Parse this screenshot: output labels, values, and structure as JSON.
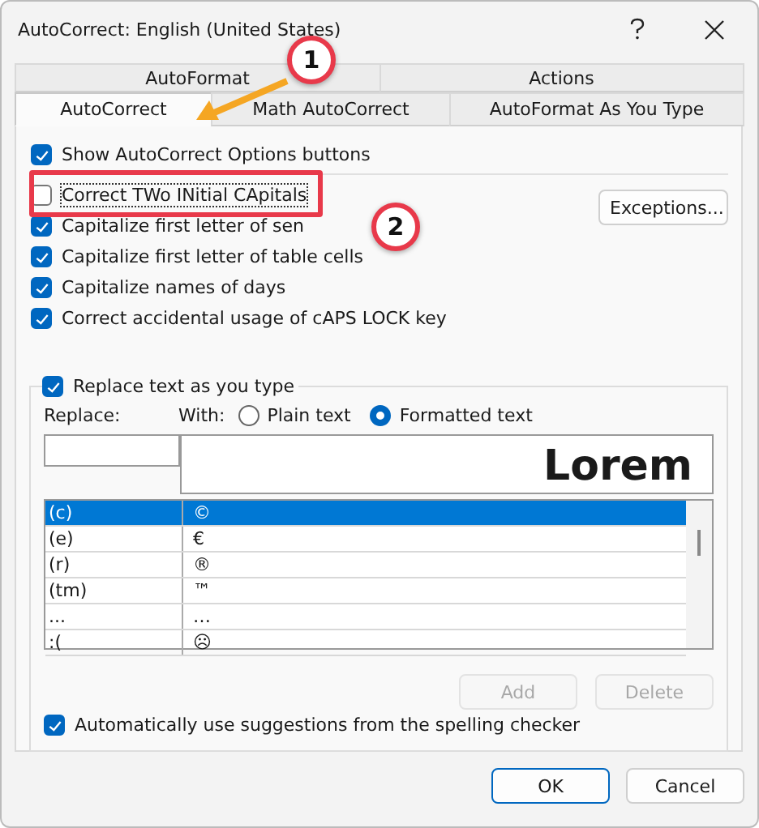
{
  "window": {
    "title": "AutoCorrect: English (United States)"
  },
  "tabs_back": [
    {
      "label": "AutoFormat",
      "selected": false
    },
    {
      "label": "Actions",
      "selected": false
    }
  ],
  "tabs_front": [
    {
      "label": "AutoCorrect",
      "selected": true
    },
    {
      "label": "Math AutoCorrect",
      "selected": false
    },
    {
      "label": "AutoFormat As You Type",
      "selected": false
    }
  ],
  "show_options": {
    "label": "Show AutoCorrect Options buttons",
    "checked": true
  },
  "options": [
    {
      "label": "Correct TWo INitial CApitals",
      "checked": false
    },
    {
      "label": "Capitalize first letter of sen",
      "checked": true
    },
    {
      "label": "Capitalize first letter of table cells",
      "checked": true
    },
    {
      "label": "Capitalize names of days",
      "checked": true
    },
    {
      "label": "Correct accidental usage of cAPS LOCK key",
      "checked": true
    }
  ],
  "exceptions_button": "Exceptions...",
  "replace_group": {
    "label": "Replace text as you type",
    "checked": true
  },
  "replace_label": "Replace:",
  "with_label": "With:",
  "format_options": [
    {
      "label": "Plain text",
      "selected": false
    },
    {
      "label": "Formatted text",
      "selected": true
    }
  ],
  "preview_text": "Lorem",
  "entries": [
    {
      "replace": "(c)",
      "with": "©",
      "selected": true
    },
    {
      "replace": "(e)",
      "with": "€",
      "selected": false
    },
    {
      "replace": "(r)",
      "with": "®",
      "selected": false
    },
    {
      "replace": "(tm)",
      "with": "™",
      "selected": false
    },
    {
      "replace": "...",
      "with": "…",
      "selected": false
    },
    {
      "replace": ":(",
      "with": "☹",
      "selected": false
    }
  ],
  "list_buttons": [
    {
      "label": "Add",
      "disabled": true
    },
    {
      "label": "Delete",
      "disabled": true
    }
  ],
  "spelling": {
    "label": "Automatically use suggestions from the spelling checker",
    "checked": true
  },
  "dialog_buttons": [
    {
      "label": "OK",
      "default": true
    },
    {
      "label": "Cancel",
      "default": false
    }
  ],
  "callouts": [
    "1",
    "2"
  ]
}
